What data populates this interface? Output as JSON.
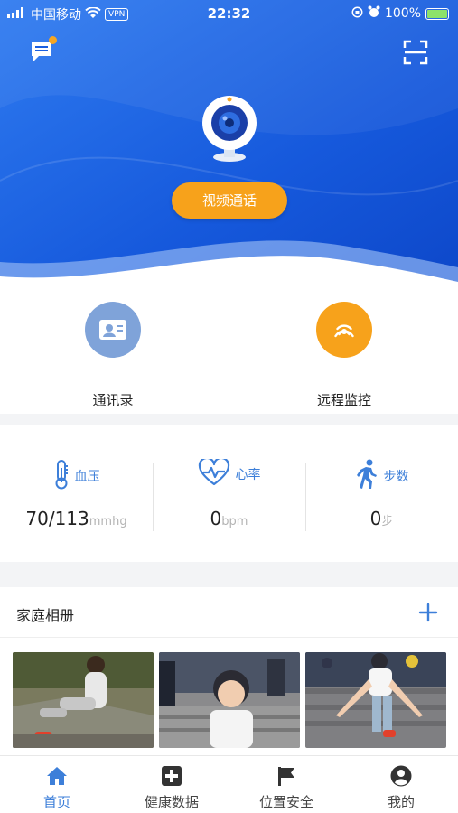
{
  "status_bar": {
    "carrier": "中国移动",
    "vpn": "VPN",
    "time": "22:32",
    "battery": "100%"
  },
  "header": {
    "message_icon": "message-icon",
    "scan_icon": "scan-icon",
    "camera_icon": "webcam-icon",
    "video_call_label": "视频通话",
    "accent_color": "#f7a21b"
  },
  "actions": [
    {
      "label": "通讯录",
      "icon": "contacts-card-icon",
      "color": "#7fa3d9"
    },
    {
      "label": "远程监控",
      "icon": "broadcast-icon",
      "color": "#f7a21b"
    }
  ],
  "metrics": [
    {
      "label": "血压",
      "icon": "thermometer-icon",
      "value": "70/113",
      "unit": "mmhg"
    },
    {
      "label": "心率",
      "icon": "heart-rate-icon",
      "value": "0",
      "unit": "bpm"
    },
    {
      "label": "步数",
      "icon": "walking-icon",
      "value": "0",
      "unit": "步"
    }
  ],
  "album": {
    "title": "家庭相册",
    "add_icon": "plus-icon",
    "photos": [
      "photo-1",
      "photo-2",
      "photo-3"
    ]
  },
  "tabs": [
    {
      "label": "首页",
      "icon": "home-icon",
      "active": true
    },
    {
      "label": "健康数据",
      "icon": "medical-cross-icon",
      "active": false
    },
    {
      "label": "位置安全",
      "icon": "flag-icon",
      "active": false
    },
    {
      "label": "我的",
      "icon": "user-icon",
      "active": false
    }
  ],
  "colors": {
    "primary": "#3d7fd9",
    "hero_blue": "#1a5fe0"
  }
}
